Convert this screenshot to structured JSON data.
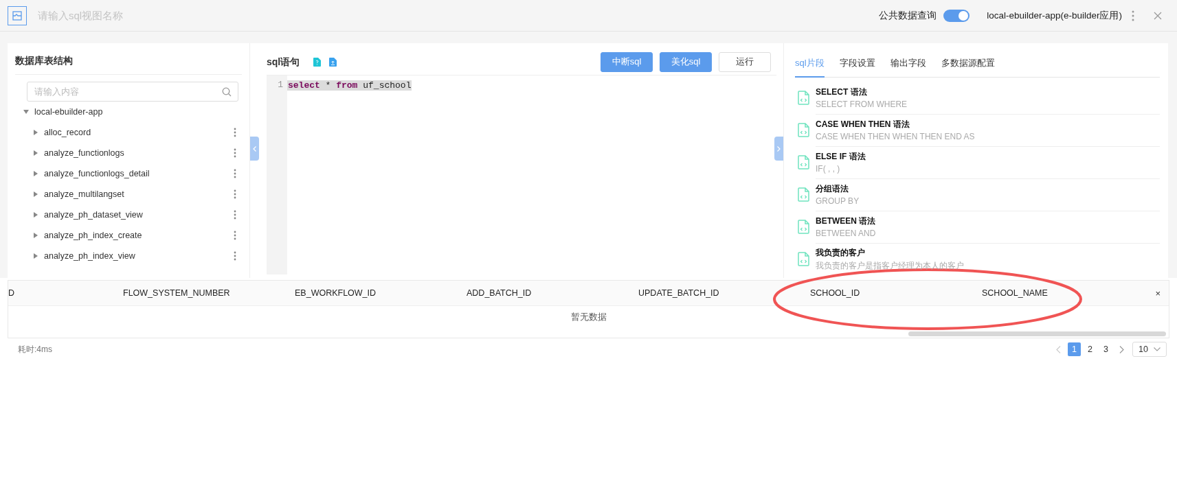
{
  "header": {
    "view_name": {
      "placeholder": "请输入sql视图名称"
    },
    "public_query": {
      "label": "公共数据查询",
      "on": true
    },
    "app_name": "local-ebuilder-app(e-builder应用)"
  },
  "db_panel": {
    "title": "数据库表结构",
    "search": {
      "placeholder": "请输入内容"
    },
    "tree": [
      {
        "label": "local-ebuilder-app",
        "expanded": true,
        "children": [
          {
            "label": "alloc_record",
            "expanded": false
          },
          {
            "label": "analyze_functionlogs",
            "expanded": false
          },
          {
            "label": "analyze_functionlogs_detail",
            "expanded": false
          },
          {
            "label": "analyze_multilangset",
            "expanded": false
          },
          {
            "label": "analyze_ph_dataset_view",
            "expanded": false
          },
          {
            "label": "analyze_ph_index_create",
            "expanded": false
          },
          {
            "label": "analyze_ph_index_view",
            "expanded": false
          }
        ]
      }
    ]
  },
  "sql_panel": {
    "title": "sql语句",
    "buttons": [
      {
        "label": "中断sql",
        "kind": "primary"
      },
      {
        "label": "美化sql",
        "kind": "primary"
      },
      {
        "label": "运行",
        "kind": "default"
      }
    ],
    "lines": [
      {
        "number": "1",
        "selected": true,
        "tokens": [
          {
            "text": "select",
            "kind": "keyword"
          },
          {
            "text": " * ",
            "kind": "plain"
          },
          {
            "text": "from",
            "kind": "keyword"
          },
          {
            "text": " uf_school",
            "kind": "plain"
          }
        ]
      }
    ]
  },
  "snippet_panel": {
    "tabs": [
      {
        "label": "sql片段",
        "selected": true
      },
      {
        "label": "字段设置",
        "selected": false
      },
      {
        "label": "输出字段",
        "selected": false
      },
      {
        "label": "多数据源配置",
        "selected": false
      }
    ],
    "snippets": [
      {
        "title": "SELECT 语法",
        "description": "SELECT FROM WHERE"
      },
      {
        "title": "CASE WHEN THEN 语法",
        "description": "CASE WHEN THEN WHEN THEN END AS"
      },
      {
        "title": "ELSE IF 语法",
        "description": "IF( , , )"
      },
      {
        "title": "分组语法",
        "description": "GROUP BY"
      },
      {
        "title": "BETWEEN 语法",
        "description": "BETWEEN AND"
      },
      {
        "title": "我负责的客户",
        "description": "我负责的客户是指客户经理为本人的客户"
      }
    ]
  },
  "results": {
    "columns": [
      "D",
      "FLOW_SYSTEM_NUMBER",
      "EB_WORKFLOW_ID",
      "ADD_BATCH_ID",
      "UPDATE_BATCH_ID",
      "SCHOOL_ID",
      "SCHOOL_NAME"
    ],
    "close": "×",
    "empty_text": "暂无数据",
    "elapsed": "耗时:4ms",
    "pages": [
      {
        "label": "1",
        "selected": true
      },
      {
        "label": "2",
        "selected": false
      },
      {
        "label": "3",
        "selected": false
      }
    ],
    "page_size": "10"
  },
  "annotation": {
    "kind": "ellipse",
    "color": "#f05454"
  }
}
